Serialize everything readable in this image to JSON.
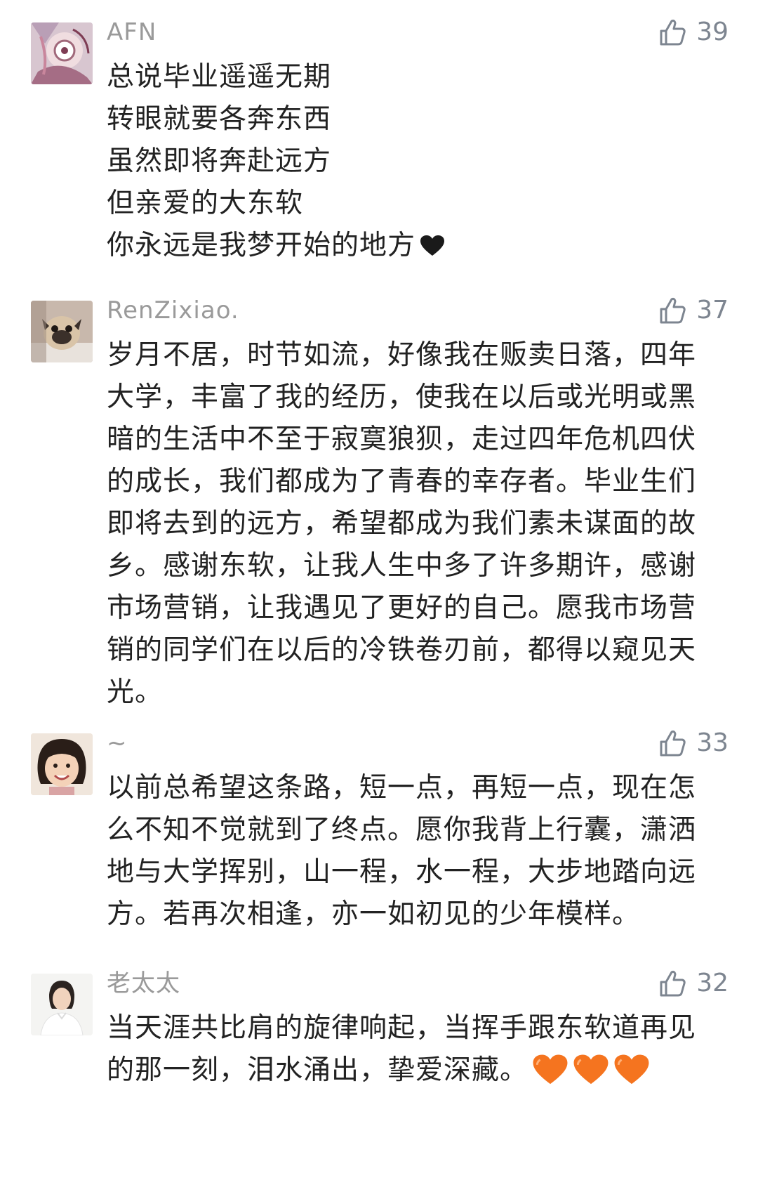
{
  "comments": [
    {
      "username": "AFN",
      "likes": "39",
      "avatar_icon": "avatar-pink-illustration",
      "lines": [
        "总说毕业遥遥无期",
        "转眼就要各奔东西",
        "虽然即将奔赴远方",
        "但亲爱的大东软",
        "你永远是我梦开始的地方"
      ],
      "trailing_emoji": "black-heart-icon"
    },
    {
      "username": "RenZixiao.",
      "likes": "37",
      "avatar_icon": "avatar-pug-dog",
      "text": "岁月不居，时节如流，好像我在贩卖日落，四年大学，丰富了我的经历，使我在以后或光明或黑暗的生活中不至于寂寞狼狈，走过四年危机四伏的成长，我们都成为了青春的幸存者。毕业生们即将去到的远方，希望都成为我们素未谋面的故乡。感谢东软，让我人生中多了许多期许，感谢市场营销，让我遇见了更好的自己。愿我市场营销的同学们在以后的冷铁卷刃前，都得以窥见天光。"
    },
    {
      "username": "~",
      "likes": "33",
      "avatar_icon": "avatar-smiling-child",
      "text": "以前总希望这条路，短一点，再短一点，现在怎么不知不觉就到了终点。愿你我背上行囊，潇洒地与大学挥别，山一程，水一程，大步地踏向远方。若再次相逢，亦一如初见的少年模样。"
    },
    {
      "username": "老太太",
      "likes": "32",
      "avatar_icon": "avatar-woman-portrait",
      "text": "当天涯共比肩的旋律响起，当挥手跟东软道再见的那一刻，泪水涌出，挚爱深藏。",
      "trailing_emoji": "orange-heart-icon x3"
    }
  ],
  "colors": {
    "username": "#9a9a9a",
    "body_text": "#222222",
    "like_icon": "#7d8590",
    "orange_heart": "#f5741f"
  }
}
